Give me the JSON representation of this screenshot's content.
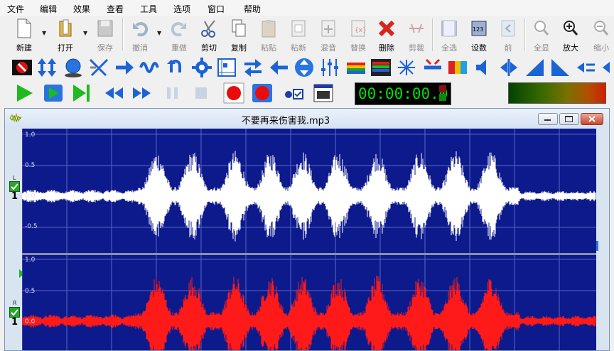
{
  "menu": [
    "文件",
    "编辑",
    "效果",
    "查看",
    "工具",
    "选项",
    "窗口",
    "帮助"
  ],
  "toolbar1": {
    "new": "新建",
    "open": "打开",
    "save": "保存",
    "undo": "撤消",
    "redo": "重做",
    "cut": "剪切",
    "copy": "复制",
    "paste": "粘贴",
    "paste_new": "粘新",
    "mix": "混音",
    "replace": "替换",
    "delete": "删除",
    "trim": "剪裁",
    "select_all": "全选",
    "set_number": "设数",
    "set_number_icon_text": "123",
    "prev": "前",
    "show_all": "全显",
    "zoom_in": "放大",
    "zoom_out": "缩小"
  },
  "toolbar2_icons": [
    "stop-sign-icon",
    "vertical-arrows-icon",
    "globe-icon",
    "crossfade-icon",
    "arrow-right-icon",
    "wave-icon",
    "loop-back-icon",
    "gear-icon",
    "graph-icon",
    "swap-icon",
    "arrow-left-icon",
    "vertical-expand-icon",
    "equalizer-icon",
    "spectrum-icon",
    "spectrum-alt-icon",
    "spread-icon",
    "compress-icon",
    "gradient-icon",
    "speaker-icon",
    "balance-icon",
    "ramp-up-icon",
    "ramp-down-icon",
    "amp-arrows-icon",
    "more-icon"
  ],
  "timer": {
    "value": "00:00:00.0"
  },
  "document": {
    "title": "不要再来伤害我.mp3"
  },
  "channels": [
    {
      "label": "L",
      "number": "1",
      "color": "#ffffff"
    },
    {
      "label": "R",
      "number": "1",
      "color": "#ff1a1a"
    }
  ],
  "amplitude_labels": [
    "1.0",
    "0.5",
    "0.0",
    "-0.5",
    "1.0",
    "0.5",
    "0.0"
  ],
  "colors": {
    "waveform_bg": "#0d1a8c",
    "left_channel": "#ffffff",
    "right_channel": "#ff1a1a",
    "timer_text": "#00e000"
  }
}
